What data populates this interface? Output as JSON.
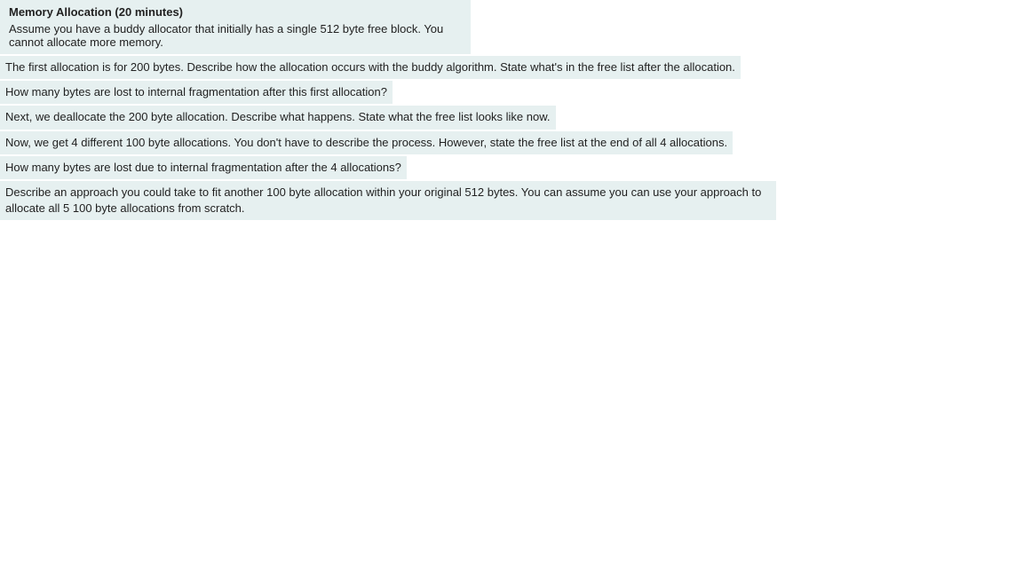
{
  "header": {
    "title": "Memory Allocation (20 minutes)",
    "description": "Assume you have a buddy allocator that initially has a single 512 byte free block. You cannot allocate more memory."
  },
  "questions": [
    "The first allocation is for 200 bytes. Describe how the allocation occurs with the buddy algorithm. State what's in the free list after the allocation.",
    "How many bytes are lost to internal fragmentation after this first allocation?",
    "Next, we deallocate the 200 byte allocation. Describe what happens. State what the free list looks like now.",
    "Now, we get 4 different 100 byte allocations. You don't have to describe the process. However, state the free list at the end of all 4 allocations.",
    "How many bytes are lost due to internal fragmentation after the 4 allocations?",
    "Describe an approach you could take to fit another 100 byte allocation within your original 512 bytes. You can assume you can use your approach to allocate all 5 100 byte allocations from scratch."
  ]
}
